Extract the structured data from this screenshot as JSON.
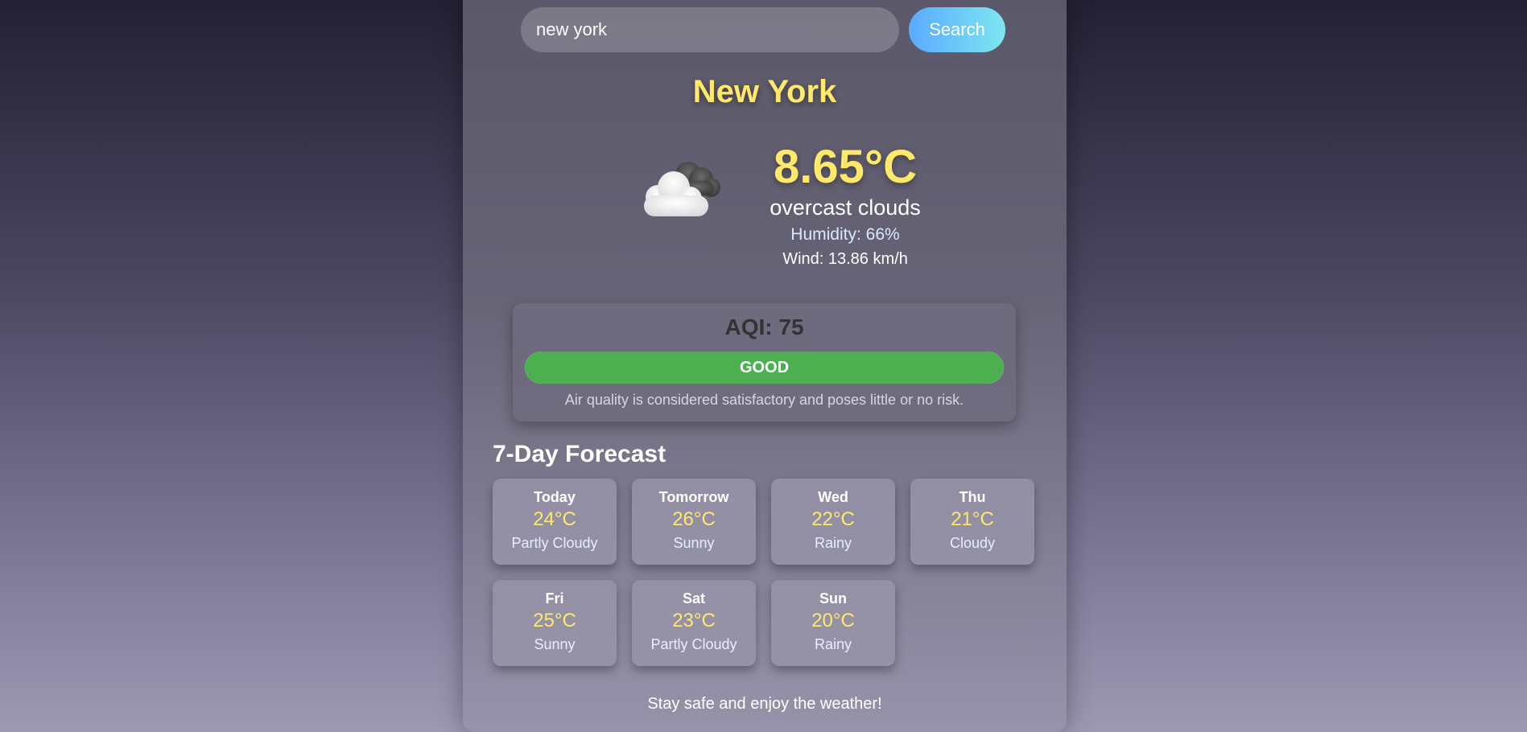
{
  "search": {
    "value": "new york",
    "button_label": "Search"
  },
  "current": {
    "city": "New York",
    "temperature": "8.65°C",
    "description": "overcast clouds",
    "humidity": "Humidity: 66%",
    "wind": "Wind: 13.86 km/h",
    "icon": "overcast-clouds-icon"
  },
  "aqi": {
    "title": "AQI: 75",
    "level": "GOOD",
    "note": "Air quality is considered satisfactory and poses little or no risk.",
    "color": "#4caf50"
  },
  "forecast": {
    "title": "7-Day Forecast",
    "days": [
      {
        "day": "Today",
        "temp": "24°C",
        "condition": "Partly Cloudy"
      },
      {
        "day": "Tomorrow",
        "temp": "26°C",
        "condition": "Sunny"
      },
      {
        "day": "Wed",
        "temp": "22°C",
        "condition": "Rainy"
      },
      {
        "day": "Thu",
        "temp": "21°C",
        "condition": "Cloudy"
      },
      {
        "day": "Fri",
        "temp": "25°C",
        "condition": "Sunny"
      },
      {
        "day": "Sat",
        "temp": "23°C",
        "condition": "Partly Cloudy"
      },
      {
        "day": "Sun",
        "temp": "20°C",
        "condition": "Rainy"
      }
    ]
  },
  "footer": {
    "text": "Stay safe and enjoy the weather!"
  },
  "colors": {
    "accent_yellow": "#ffe86a",
    "search_button_start": "#5aaaff",
    "search_button_end": "#7ee6f0"
  }
}
